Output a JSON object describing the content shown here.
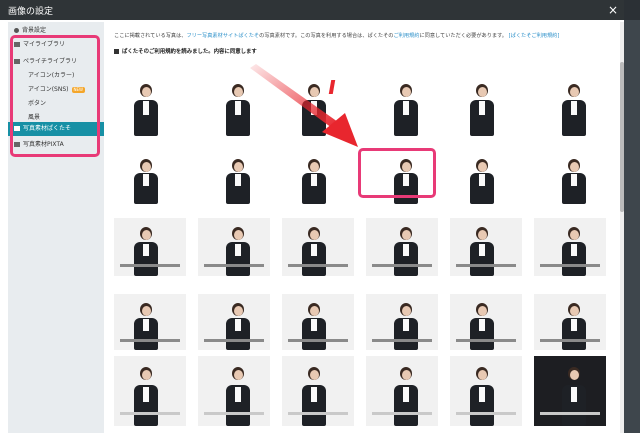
{
  "modal": {
    "title": "画像の設定",
    "close_label": "×"
  },
  "sidebar": {
    "items": [
      {
        "label": "背景設定",
        "type": "gear"
      },
      {
        "label": "マイライブラリ",
        "type": "folder"
      },
      {
        "label": "ペライチライブラリ",
        "type": "folder"
      },
      {
        "label": "アイコン(カラー)",
        "type": "sub"
      },
      {
        "label": "アイコン(SNS)",
        "type": "sub",
        "badge": "NEW"
      },
      {
        "label": "ボタン",
        "type": "sub"
      },
      {
        "label": "風景",
        "type": "sub"
      },
      {
        "label": "写真素材ぱくたそ",
        "type": "folder",
        "active": true
      },
      {
        "label": "写真素材PIXTA",
        "type": "folder"
      }
    ]
  },
  "notice": {
    "prefix": "ここに掲載されている写真は、",
    "link1": "フリー写真素材サイトぱくたそ",
    "middle": "の写真素材です。この写真を利用する場合は、ぱくたその",
    "link2": "ご利用規約",
    "suffix": "に同意していただく必要があります。",
    "link3": "[ぱくたそご利用規約]"
  },
  "agree": {
    "label": "ぱくたそのご利用規約を読みました。内容に同意します"
  },
  "colors": {
    "accent": "#1790a5",
    "highlight": "#e83a77",
    "arrow": "#e8262e",
    "header": "#2f3437"
  }
}
